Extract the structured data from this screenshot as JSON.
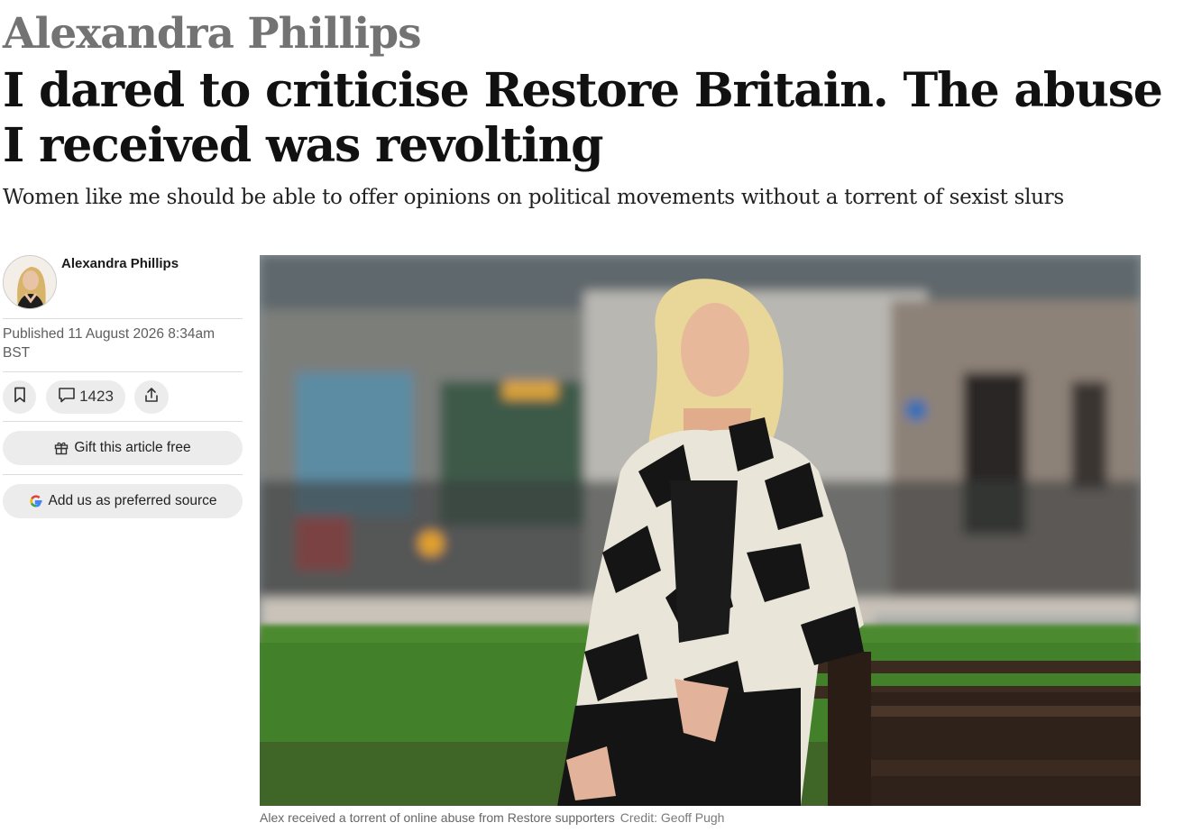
{
  "article": {
    "kicker": "Alexandra Phillips",
    "headline": "I dared to criticise Restore Britain. The abuse I received was revolting",
    "standfirst": "Women like me should be able to offer opinions on political movements without a torrent of sexist slurs"
  },
  "byline": {
    "author_name": "Alexandra Phillips",
    "avatar_icon": "author-avatar",
    "published": "Published 11 August 2026 8:34am BST"
  },
  "actions": {
    "bookmark_icon": "bookmark-icon",
    "comment_icon": "comment-icon",
    "comment_count": "1423",
    "share_icon": "share-icon",
    "gift_label": "Gift this article free",
    "gift_icon": "gift-icon",
    "preferred_source_label": "Add us as preferred source",
    "google_icon": "google-icon"
  },
  "image": {
    "caption": "Alex received a torrent of online abuse from Restore supporters",
    "credit": "Credit: Geoff Pugh"
  },
  "colors": {
    "kicker": "#737373",
    "pill_background": "#ececec",
    "text": "#1a1a1a"
  }
}
